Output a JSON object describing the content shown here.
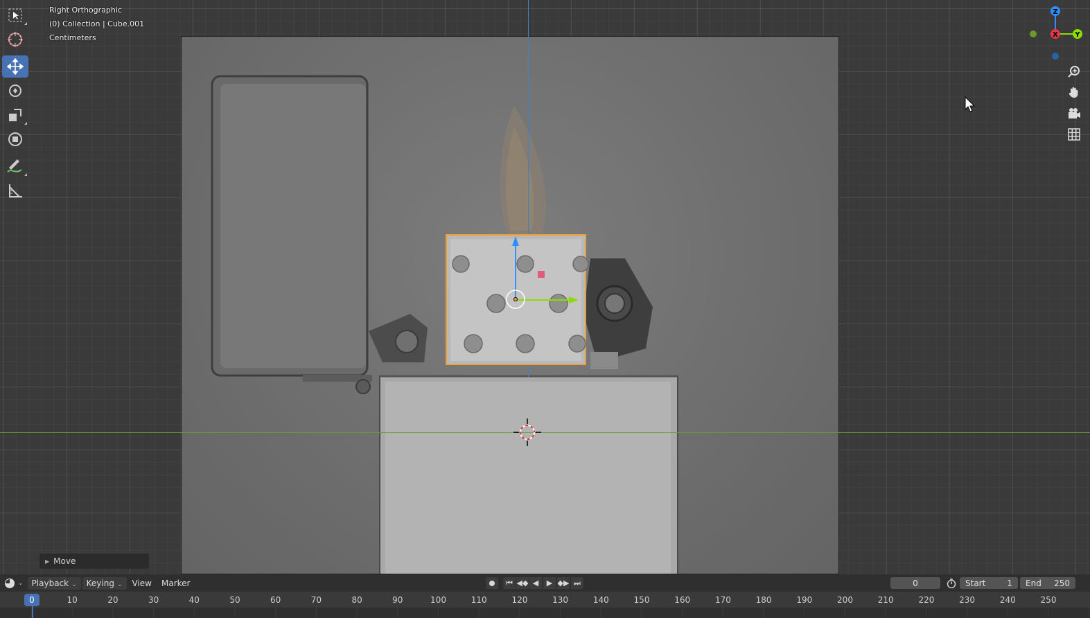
{
  "viewport": {
    "view_name": "Right Orthographic",
    "collection_info": "(0) Collection | Cube.001",
    "units": "Centimeters"
  },
  "gizmo": {
    "x_label": "X",
    "y_label": "Y",
    "z_label": "Z"
  },
  "colors": {
    "accent": "#4772b3",
    "selection": "#f0a033",
    "x_axis": "#e5364a",
    "y_axis": "#8bdc00",
    "z_axis": "#2c8fff"
  },
  "toolbar": {
    "tools": [
      "select-box",
      "cursor",
      "move",
      "rotate",
      "scale",
      "transform",
      "annotate",
      "measure"
    ],
    "active": "move"
  },
  "last_operator": {
    "label": "Move"
  },
  "timeline": {
    "menus": {
      "playback": "Playback",
      "keying": "Keying",
      "view": "View",
      "marker": "Marker"
    },
    "current_frame": "0",
    "start_label": "Start",
    "start_value": "1",
    "end_label": "End",
    "end_value": "250",
    "ruler_ticks": [
      "10",
      "20",
      "30",
      "40",
      "50",
      "60",
      "70",
      "80",
      "90",
      "100",
      "110",
      "120",
      "130",
      "140",
      "150",
      "160",
      "170",
      "180",
      "190",
      "200",
      "210",
      "220",
      "230",
      "240",
      "250"
    ],
    "playhead_frame": "0"
  }
}
